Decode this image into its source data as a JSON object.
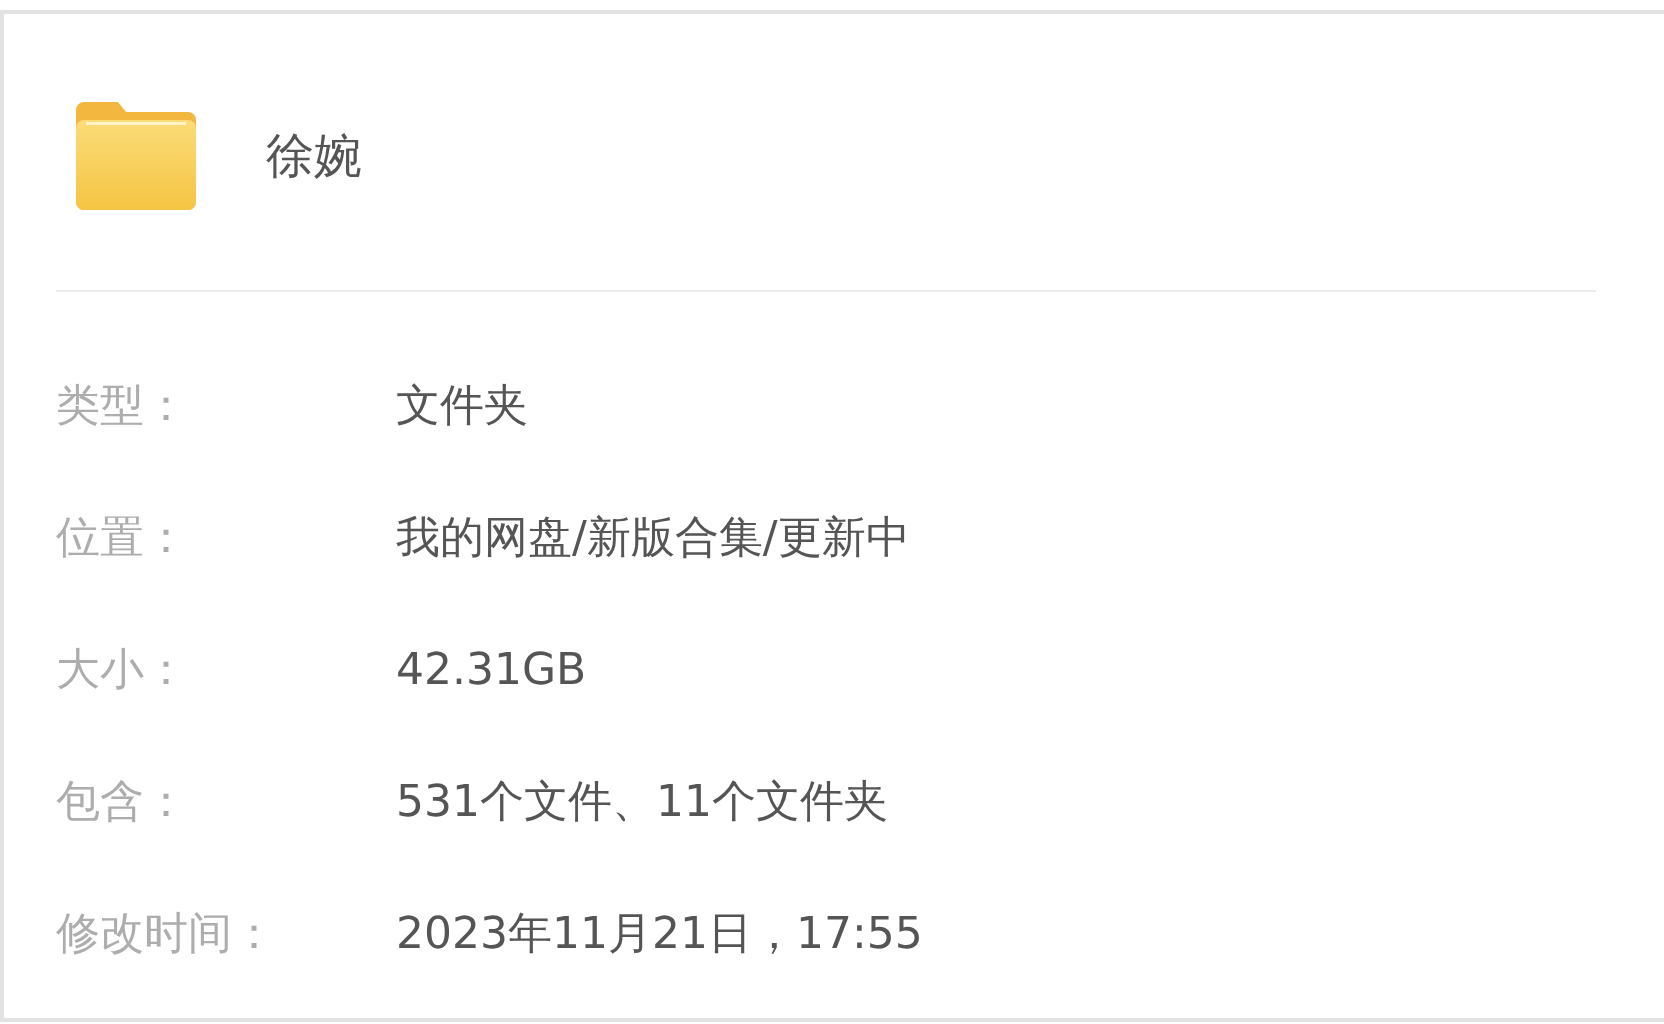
{
  "folder": {
    "name": "徐婉"
  },
  "details": [
    {
      "label": "类型：",
      "value": "文件夹"
    },
    {
      "label": "位置：",
      "value": "我的网盘/新版合集/更新中"
    },
    {
      "label": "大小：",
      "value": "42.31GB"
    },
    {
      "label": "包含：",
      "value": "531个文件、11个文件夹"
    },
    {
      "label": "修改时间：",
      "value": "2023年11月21日，17:55"
    }
  ]
}
